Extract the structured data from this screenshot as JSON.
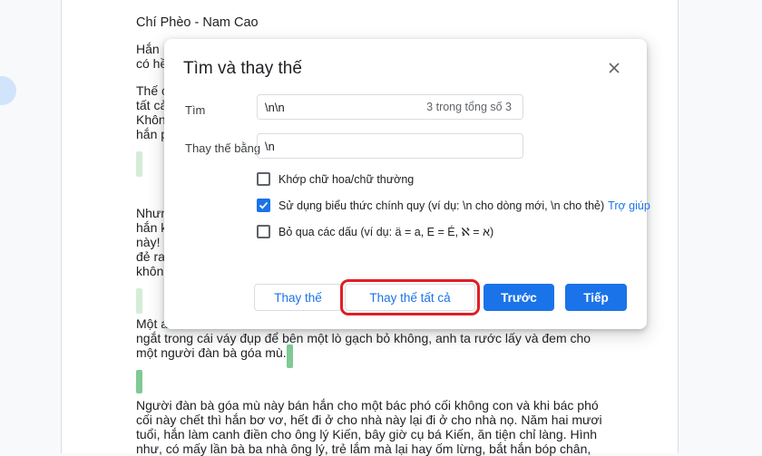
{
  "document": {
    "title": "Chí Phèo -  Nam Cao",
    "paragraphs": [
      [
        "Hắn",
        "có hề"
      ],
      [
        "Thế c",
        "tất cả",
        "Khôn",
        "hắn p"
      ],
      [
        "Nhưn",
        "hắn k",
        "này!",
        "đẻ ra",
        "khôn"
      ],
      [
        "Một a",
        "ngắt trong cái váy đụp để bên một lò gạch bỏ không, anh ta rước lấy và đem cho",
        "một người đàn bà góa mù."
      ],
      [
        "Người đàn bà góa mù này bán hắn cho một bác phó cối không con và khi bác phó",
        "cối này chết thì hắn bơ vơ, hết đi ở cho nhà này lại đi ở cho nhà nọ. Năm hai mươi",
        "tuổi, hắn làm canh điền cho ông lý Kiến, bây giờ cụ bá Kiến, ăn tiện chỉ làng. Hình",
        "như, có mấy lần bà ba nhà ông lý, trẻ lắm mà lại hay ốm lừng, bắt hắn bóp chân,"
      ]
    ]
  },
  "dialog": {
    "title": "Tìm và thay thế",
    "close_icon": "close-icon",
    "find": {
      "label": "Tìm",
      "value": "\\n\\n",
      "count": "3 trong tổng số 3"
    },
    "replace": {
      "label": "Thay thế bằng",
      "value": "\\n"
    },
    "options": [
      {
        "label": "Khớp chữ hoa/chữ thường",
        "checked": false
      },
      {
        "label": "Sử dụng biểu thức chính quy (ví dụ: \\n cho dòng mới, \\n cho thẻ)",
        "checked": true,
        "link": "Trợ giúp"
      },
      {
        "label": "Bỏ qua các dấu (ví dụ: ä = a, E = É, ℵ = א)",
        "checked": false
      }
    ],
    "buttons": {
      "replace": "Thay thế",
      "replace_all": "Thay thế tất cả",
      "previous": "Trước",
      "next": "Tiếp"
    }
  },
  "colors": {
    "primary": "#1a73e8",
    "highlight_border": "#e01e25",
    "marker_light": "#d5ecd9",
    "marker_strong": "#81c995"
  }
}
